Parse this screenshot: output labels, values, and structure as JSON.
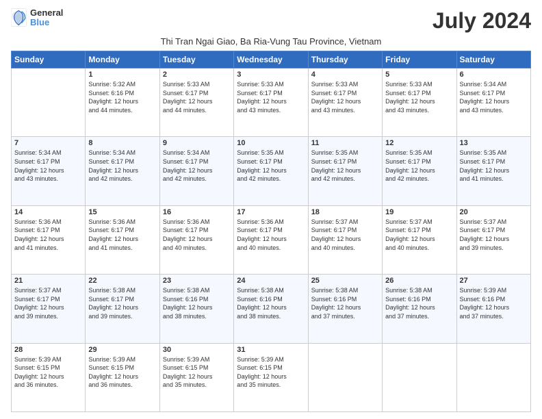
{
  "header": {
    "logo_general": "General",
    "logo_blue": "Blue",
    "month_title": "July 2024",
    "subtitle": "Thi Tran Ngai Giao, Ba Ria-Vung Tau Province, Vietnam"
  },
  "columns": [
    "Sunday",
    "Monday",
    "Tuesday",
    "Wednesday",
    "Thursday",
    "Friday",
    "Saturday"
  ],
  "weeks": [
    {
      "days": [
        {
          "num": "",
          "info": ""
        },
        {
          "num": "1",
          "info": "Sunrise: 5:32 AM\nSunset: 6:16 PM\nDaylight: 12 hours\nand 44 minutes."
        },
        {
          "num": "2",
          "info": "Sunrise: 5:33 AM\nSunset: 6:17 PM\nDaylight: 12 hours\nand 44 minutes."
        },
        {
          "num": "3",
          "info": "Sunrise: 5:33 AM\nSunset: 6:17 PM\nDaylight: 12 hours\nand 43 minutes."
        },
        {
          "num": "4",
          "info": "Sunrise: 5:33 AM\nSunset: 6:17 PM\nDaylight: 12 hours\nand 43 minutes."
        },
        {
          "num": "5",
          "info": "Sunrise: 5:33 AM\nSunset: 6:17 PM\nDaylight: 12 hours\nand 43 minutes."
        },
        {
          "num": "6",
          "info": "Sunrise: 5:34 AM\nSunset: 6:17 PM\nDaylight: 12 hours\nand 43 minutes."
        }
      ]
    },
    {
      "days": [
        {
          "num": "7",
          "info": "Sunrise: 5:34 AM\nSunset: 6:17 PM\nDaylight: 12 hours\nand 43 minutes."
        },
        {
          "num": "8",
          "info": "Sunrise: 5:34 AM\nSunset: 6:17 PM\nDaylight: 12 hours\nand 42 minutes."
        },
        {
          "num": "9",
          "info": "Sunrise: 5:34 AM\nSunset: 6:17 PM\nDaylight: 12 hours\nand 42 minutes."
        },
        {
          "num": "10",
          "info": "Sunrise: 5:35 AM\nSunset: 6:17 PM\nDaylight: 12 hours\nand 42 minutes."
        },
        {
          "num": "11",
          "info": "Sunrise: 5:35 AM\nSunset: 6:17 PM\nDaylight: 12 hours\nand 42 minutes."
        },
        {
          "num": "12",
          "info": "Sunrise: 5:35 AM\nSunset: 6:17 PM\nDaylight: 12 hours\nand 42 minutes."
        },
        {
          "num": "13",
          "info": "Sunrise: 5:35 AM\nSunset: 6:17 PM\nDaylight: 12 hours\nand 41 minutes."
        }
      ]
    },
    {
      "days": [
        {
          "num": "14",
          "info": "Sunrise: 5:36 AM\nSunset: 6:17 PM\nDaylight: 12 hours\nand 41 minutes."
        },
        {
          "num": "15",
          "info": "Sunrise: 5:36 AM\nSunset: 6:17 PM\nDaylight: 12 hours\nand 41 minutes."
        },
        {
          "num": "16",
          "info": "Sunrise: 5:36 AM\nSunset: 6:17 PM\nDaylight: 12 hours\nand 40 minutes."
        },
        {
          "num": "17",
          "info": "Sunrise: 5:36 AM\nSunset: 6:17 PM\nDaylight: 12 hours\nand 40 minutes."
        },
        {
          "num": "18",
          "info": "Sunrise: 5:37 AM\nSunset: 6:17 PM\nDaylight: 12 hours\nand 40 minutes."
        },
        {
          "num": "19",
          "info": "Sunrise: 5:37 AM\nSunset: 6:17 PM\nDaylight: 12 hours\nand 40 minutes."
        },
        {
          "num": "20",
          "info": "Sunrise: 5:37 AM\nSunset: 6:17 PM\nDaylight: 12 hours\nand 39 minutes."
        }
      ]
    },
    {
      "days": [
        {
          "num": "21",
          "info": "Sunrise: 5:37 AM\nSunset: 6:17 PM\nDaylight: 12 hours\nand 39 minutes."
        },
        {
          "num": "22",
          "info": "Sunrise: 5:38 AM\nSunset: 6:17 PM\nDaylight: 12 hours\nand 39 minutes."
        },
        {
          "num": "23",
          "info": "Sunrise: 5:38 AM\nSunset: 6:16 PM\nDaylight: 12 hours\nand 38 minutes."
        },
        {
          "num": "24",
          "info": "Sunrise: 5:38 AM\nSunset: 6:16 PM\nDaylight: 12 hours\nand 38 minutes."
        },
        {
          "num": "25",
          "info": "Sunrise: 5:38 AM\nSunset: 6:16 PM\nDaylight: 12 hours\nand 37 minutes."
        },
        {
          "num": "26",
          "info": "Sunrise: 5:38 AM\nSunset: 6:16 PM\nDaylight: 12 hours\nand 37 minutes."
        },
        {
          "num": "27",
          "info": "Sunrise: 5:39 AM\nSunset: 6:16 PM\nDaylight: 12 hours\nand 37 minutes."
        }
      ]
    },
    {
      "days": [
        {
          "num": "28",
          "info": "Sunrise: 5:39 AM\nSunset: 6:15 PM\nDaylight: 12 hours\nand 36 minutes."
        },
        {
          "num": "29",
          "info": "Sunrise: 5:39 AM\nSunset: 6:15 PM\nDaylight: 12 hours\nand 36 minutes."
        },
        {
          "num": "30",
          "info": "Sunrise: 5:39 AM\nSunset: 6:15 PM\nDaylight: 12 hours\nand 35 minutes."
        },
        {
          "num": "31",
          "info": "Sunrise: 5:39 AM\nSunset: 6:15 PM\nDaylight: 12 hours\nand 35 minutes."
        },
        {
          "num": "",
          "info": ""
        },
        {
          "num": "",
          "info": ""
        },
        {
          "num": "",
          "info": ""
        }
      ]
    }
  ]
}
